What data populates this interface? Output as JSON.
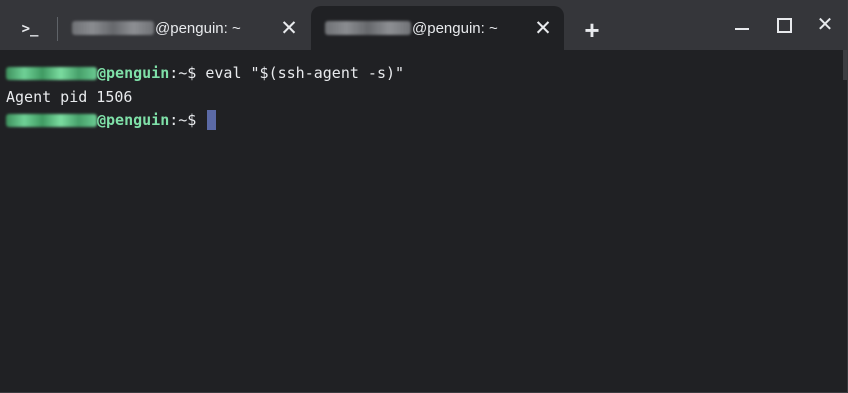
{
  "tabs": [
    {
      "title": "@penguin: ~",
      "active": false
    },
    {
      "title": "@penguin: ~",
      "active": true
    }
  ],
  "icons": {
    "launcher": "terminal-prompt-icon",
    "tab_close": "close-icon",
    "new_tab": "plus-icon",
    "minimize": "minimize-icon",
    "maximize": "maximize-icon",
    "close": "close-icon"
  },
  "glyphs": {
    "launcher": ">_",
    "tab_close": "✕",
    "new_tab": "+",
    "close": "✕"
  },
  "terminal": {
    "lines": [
      {
        "host": "@penguin",
        "path": ":~$",
        "command": " eval \"$(ssh-agent -s)\""
      },
      {
        "output": "Agent pid 1506"
      },
      {
        "host": "@penguin",
        "path": ":~$",
        "command": " "
      }
    ]
  },
  "colors": {
    "background": "#202124",
    "tabstrip": "#35363a",
    "prompt_host": "#7fe0a8",
    "cursor": "#5b6aa6"
  }
}
